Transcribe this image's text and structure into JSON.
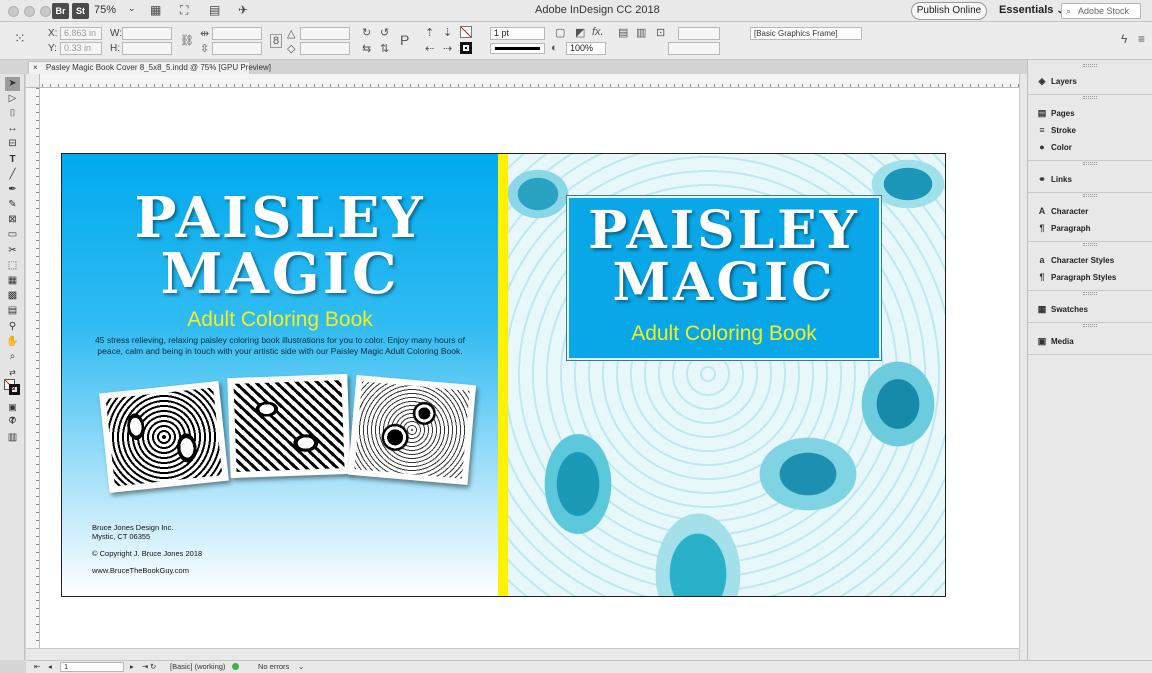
{
  "window": {
    "title": "Adobe InDesign CC 2018",
    "zoom": "75%",
    "bridge_label": "Br",
    "stock_label": "St"
  },
  "header": {
    "publish_label": "Publish Online",
    "workspace_label": "Essentials",
    "search_placeholder": "Adobe Stock"
  },
  "control": {
    "x_label": "X:",
    "x_value": "6.863 in",
    "y_label": "Y:",
    "y_value": "0.33 in",
    "w_label": "W:",
    "h_label": "H:",
    "stroke_weight": "1 pt",
    "opacity": "100%",
    "object_style": "[Basic Graphics Frame]",
    "fx_label": "fx."
  },
  "document": {
    "tab_label": "Pasley Magic Book Cover 8_5x8_5.indd @ 75% [GPU Preview]",
    "close_glyph": "×"
  },
  "back_cover": {
    "title_line1": "PAISLEY",
    "title_line2": "MAGIC",
    "subtitle": "Adult Coloring Book",
    "description": "45 stress relieving, relaxing paisley coloring book illustrations for you to color. Enjoy many hours of peace, calm and being in touch with your artistic side with our Paisley Magic Adult Coloring Book.",
    "company": "Bruce Jones Design Inc.",
    "location": "Mystic, CT 06355",
    "copyright": "© Copyright J. Bruce Jones 2018",
    "website": "www.BruceTheBookGuy.com"
  },
  "front_cover": {
    "title_line1": "PAISLEY",
    "title_line2": "MAGIC",
    "subtitle": "Adult Coloring Book"
  },
  "panels": {
    "groups": [
      [
        {
          "label": "Layers",
          "icon": "layers-icon"
        }
      ],
      [
        {
          "label": "Pages",
          "icon": "pages-icon"
        },
        {
          "label": "Stroke",
          "icon": "stroke-icon"
        },
        {
          "label": "Color",
          "icon": "color-icon"
        }
      ],
      [
        {
          "label": "Links",
          "icon": "links-icon"
        }
      ],
      [
        {
          "label": "Character",
          "icon": "character-icon"
        },
        {
          "label": "Paragraph",
          "icon": "paragraph-icon"
        }
      ],
      [
        {
          "label": "Character Styles",
          "icon": "character-styles-icon"
        },
        {
          "label": "Paragraph Styles",
          "icon": "paragraph-styles-icon"
        }
      ],
      [
        {
          "label": "Swatches",
          "icon": "swatches-icon"
        }
      ],
      [
        {
          "label": "Media",
          "icon": "media-icon"
        }
      ]
    ]
  },
  "status": {
    "page_number": "1",
    "preflight_profile": "[Basic] (working)",
    "errors_label": "No errors"
  },
  "colors": {
    "back_blue": "#00aaee",
    "spine_yellow": "#fff200",
    "subtitle_yellow": "#f5ef1c",
    "front_box_blue": "#0aa7e8"
  }
}
